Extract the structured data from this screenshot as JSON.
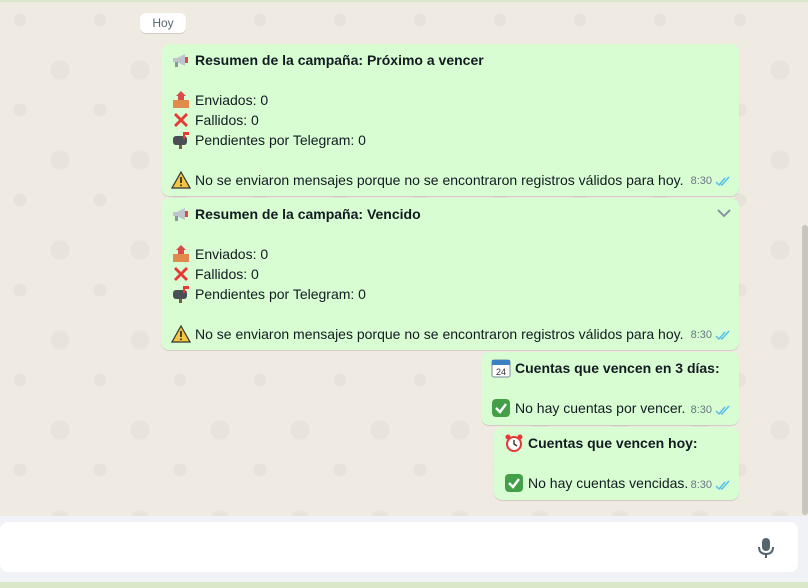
{
  "chat": {
    "day_label": "Hoy",
    "messages": [
      {
        "title": "Resumen de la campaña: Próximo a vencer",
        "lines": [
          "Enviados: 0",
          "Fallidos: 0",
          "Pendientes por Telegram: 0"
        ],
        "warning": "No se enviaron mensajes porque no se encontraron registros válidos para hoy.",
        "time": "8:30"
      },
      {
        "title": "Resumen de la campaña: Vencido",
        "lines": [
          "Enviados: 0",
          "Fallidos: 0",
          "Pendientes por Telegram: 0"
        ],
        "warning": "No se enviaron mensajes porque no se encontraron registros válidos para hoy.",
        "time": "8:30"
      },
      {
        "title": "Cuentas que vencen en 3 días:",
        "body": "No hay cuentas por vencer.",
        "time": "8:30"
      },
      {
        "title": "Cuentas que vencen hoy:",
        "body": "No hay cuentas vencidas.",
        "time": "8:30"
      }
    ],
    "calendar_icon_text": "24"
  },
  "icons": {
    "megaphone": "megaphone-icon",
    "outbox": "outbox-tray-icon",
    "cross": "cross-mark-icon",
    "mailbox": "mailbox-icon",
    "warning": "warning-icon",
    "calendar": "calendar-icon",
    "alarm": "alarm-clock-icon",
    "check": "check-box-icon",
    "read_ticks": "double-check-icon",
    "mic": "microphone-icon",
    "menu": "chevron-down-icon"
  },
  "colors": {
    "bubble": "#d9fdd3",
    "background": "#efeae2",
    "ticks": "#53bdeb",
    "meta": "#667781"
  }
}
